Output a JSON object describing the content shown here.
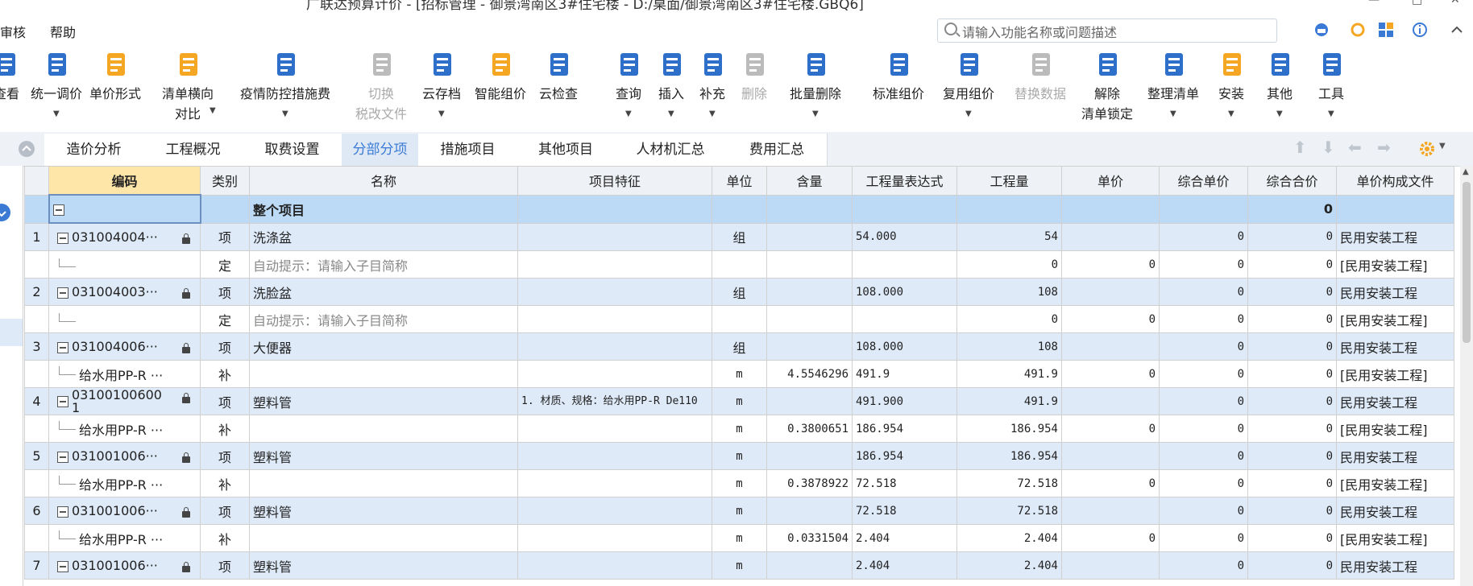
{
  "window": {
    "title": "广联达预算计价 - [招标管理 - 御景湾南区3#住宅楼 - D:/桌面/御景湾南区3#住宅楼.GBQ6]"
  },
  "menu": {
    "items": [
      "审核",
      "帮助"
    ]
  },
  "search": {
    "placeholder": "请输入功能名称或问题描述"
  },
  "toolbar": {
    "items": [
      {
        "label": "查看",
        "color": "#2e6fc9"
      },
      {
        "label": "统一调价",
        "color": "#2e6fc9"
      },
      {
        "label": "单价形式",
        "color": "#f5a623"
      },
      {
        "label": "清单横向",
        "label2": "对比",
        "color": "#f5a623"
      },
      {
        "label": "疫情防控措施费",
        "color": "#2e6fc9"
      },
      {
        "label": "切换",
        "label2": "税改文件",
        "color": "#bbbbbb",
        "disabled": true
      },
      {
        "label": "云存档",
        "color": "#2e6fc9"
      },
      {
        "label": "智能组价",
        "color": "#f5a623"
      },
      {
        "label": "云检查",
        "color": "#2e6fc9"
      },
      {
        "label": "查询",
        "color": "#2e6fc9"
      },
      {
        "label": "插入",
        "color": "#2e6fc9"
      },
      {
        "label": "补充",
        "color": "#2e6fc9"
      },
      {
        "label": "删除",
        "color": "#bbbbbb",
        "disabled": true
      },
      {
        "label": "批量删除",
        "color": "#2e6fc9"
      },
      {
        "label": "标准组价",
        "color": "#2e6fc9"
      },
      {
        "label": "复用组价",
        "color": "#2e6fc9"
      },
      {
        "label": "替换数据",
        "color": "#bbbbbb",
        "disabled": true
      },
      {
        "label": "解除",
        "label2": "清单锁定",
        "color": "#2e6fc9"
      },
      {
        "label": "整理清单",
        "color": "#2e6fc9"
      },
      {
        "label": "安装",
        "color": "#f5a623"
      },
      {
        "label": "其他",
        "color": "#2e6fc9"
      },
      {
        "label": "工具",
        "color": "#2e6fc9"
      }
    ]
  },
  "tabs": [
    "造价分析",
    "工程概况",
    "取费设置",
    "分部分项",
    "措施项目",
    "其他项目",
    "人材机汇总",
    "费用汇总"
  ],
  "active_tab": "分部分项",
  "columns": [
    "编码",
    "类别",
    "名称",
    "项目特征",
    "单位",
    "含量",
    "工程量表达式",
    "工程量",
    "单价",
    "综合单价",
    "综合合价",
    "单价构成文件"
  ],
  "root_row": {
    "name": "整个项目",
    "total": "0"
  },
  "rows": [
    {
      "seq": "1",
      "kind": "item",
      "code": "031004004···",
      "cat": "项",
      "name": "洗涤盆",
      "feature": "",
      "unit": "组",
      "qty_ratio": "",
      "expr": "54.000",
      "qty": "54",
      "price": "",
      "unit_price": "0",
      "total": "0",
      "file": "民用安装工程"
    },
    {
      "seq": "",
      "kind": "sub",
      "code": "",
      "cat": "定",
      "name": "自动提示：请输入子目简称",
      "feature": "",
      "unit": "",
      "qty_ratio": "",
      "expr": "",
      "qty": "0",
      "price": "0",
      "unit_price": "0",
      "total": "0",
      "file": "[民用安装工程]"
    },
    {
      "seq": "2",
      "kind": "item",
      "code": "031004003···",
      "cat": "项",
      "name": "洗脸盆",
      "feature": "",
      "unit": "组",
      "qty_ratio": "",
      "expr": "108.000",
      "qty": "108",
      "price": "",
      "unit_price": "0",
      "total": "0",
      "file": "民用安装工程"
    },
    {
      "seq": "",
      "kind": "sub",
      "code": "",
      "cat": "定",
      "name": "自动提示：请输入子目简称",
      "feature": "",
      "unit": "",
      "qty_ratio": "",
      "expr": "",
      "qty": "0",
      "price": "0",
      "unit_price": "0",
      "total": "0",
      "file": "[民用安装工程]"
    },
    {
      "seq": "3",
      "kind": "item",
      "code": "031004006···",
      "cat": "项",
      "name": "大便器",
      "feature": "",
      "unit": "组",
      "qty_ratio": "",
      "expr": "108.000",
      "qty": "108",
      "price": "",
      "unit_price": "0",
      "total": "0",
      "file": "民用安装工程"
    },
    {
      "seq": "",
      "kind": "sub",
      "code": "给水用PP-R ···",
      "cat": "补",
      "name": "",
      "feature": "",
      "unit": "m",
      "qty_ratio": "4.5546296",
      "expr": "491.9",
      "qty": "491.9",
      "price": "0",
      "unit_price": "0",
      "total": "0",
      "file": "[民用安装工程]"
    },
    {
      "seq": "4",
      "kind": "item",
      "code": "03100100600 1",
      "cat": "项",
      "name": "塑料管",
      "feature": "1. 材质、规格：给水用PP-R De110",
      "unit": "m",
      "qty_ratio": "",
      "expr": "491.900",
      "qty": "491.9",
      "price": "",
      "unit_price": "0",
      "total": "0",
      "file": "民用安装工程"
    },
    {
      "seq": "",
      "kind": "sub",
      "code": "给水用PP-R ···",
      "cat": "补",
      "name": "",
      "feature": "",
      "unit": "m",
      "qty_ratio": "0.3800651",
      "expr": "186.954",
      "qty": "186.954",
      "price": "0",
      "unit_price": "0",
      "total": "0",
      "file": "[民用安装工程]"
    },
    {
      "seq": "5",
      "kind": "item",
      "code": "031001006···",
      "cat": "项",
      "name": "塑料管",
      "feature": "",
      "unit": "m",
      "qty_ratio": "",
      "expr": "186.954",
      "qty": "186.954",
      "price": "",
      "unit_price": "0",
      "total": "0",
      "file": "民用安装工程"
    },
    {
      "seq": "",
      "kind": "sub",
      "code": "给水用PP-R ···",
      "cat": "补",
      "name": "",
      "feature": "",
      "unit": "m",
      "qty_ratio": "0.3878922",
      "expr": "72.518",
      "qty": "72.518",
      "price": "0",
      "unit_price": "0",
      "total": "0",
      "file": "[民用安装工程]"
    },
    {
      "seq": "6",
      "kind": "item",
      "code": "031001006···",
      "cat": "项",
      "name": "塑料管",
      "feature": "",
      "unit": "m",
      "qty_ratio": "",
      "expr": "72.518",
      "qty": "72.518",
      "price": "",
      "unit_price": "0",
      "total": "0",
      "file": "民用安装工程"
    },
    {
      "seq": "",
      "kind": "sub",
      "code": "给水用PP-R ···",
      "cat": "补",
      "name": "",
      "feature": "",
      "unit": "m",
      "qty_ratio": "0.0331504",
      "expr": "2.404",
      "qty": "2.404",
      "price": "0",
      "unit_price": "0",
      "total": "0",
      "file": "[民用安装工程]"
    },
    {
      "seq": "7",
      "kind": "item",
      "code": "031001006···",
      "cat": "项",
      "name": "塑料管",
      "feature": "",
      "unit": "m",
      "qty_ratio": "",
      "expr": "2.404",
      "qty": "2.404",
      "price": "",
      "unit_price": "0",
      "total": "0",
      "file": "民用安装工程"
    }
  ]
}
